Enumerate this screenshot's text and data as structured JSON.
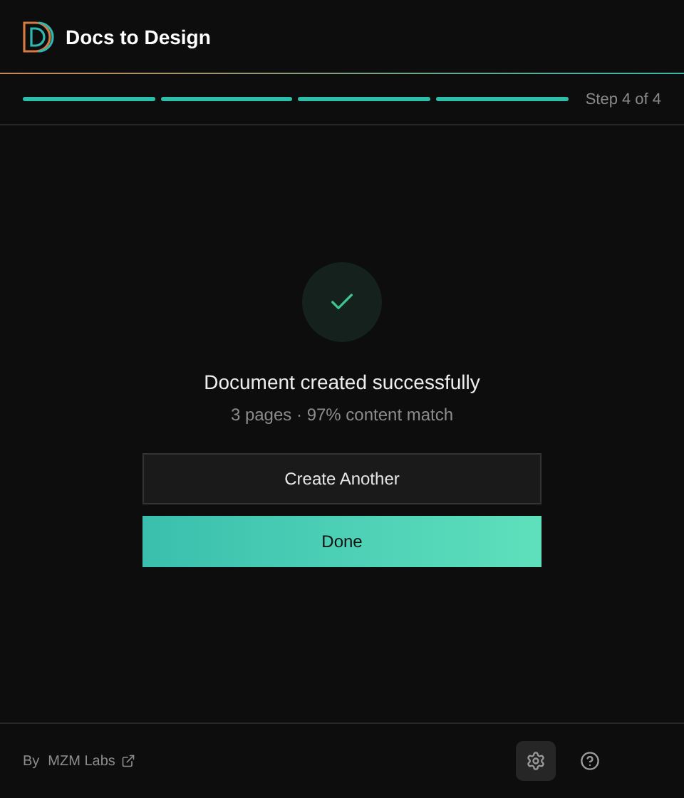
{
  "header": {
    "title": "Docs to Design"
  },
  "progress": {
    "steps": [
      {
        "complete": true
      },
      {
        "complete": true
      },
      {
        "complete": true
      },
      {
        "complete": true
      }
    ],
    "label": "Step 4 of 4"
  },
  "result": {
    "title": "Document created successfully",
    "subtitle": "3 pages · 97% content match"
  },
  "buttons": [
    {
      "kind": "secondary",
      "label": "Create Another"
    },
    {
      "kind": "primary",
      "label": "Done"
    }
  ],
  "footer": {
    "by": "By",
    "link": "MZM Labs",
    "settings_active": true
  }
}
